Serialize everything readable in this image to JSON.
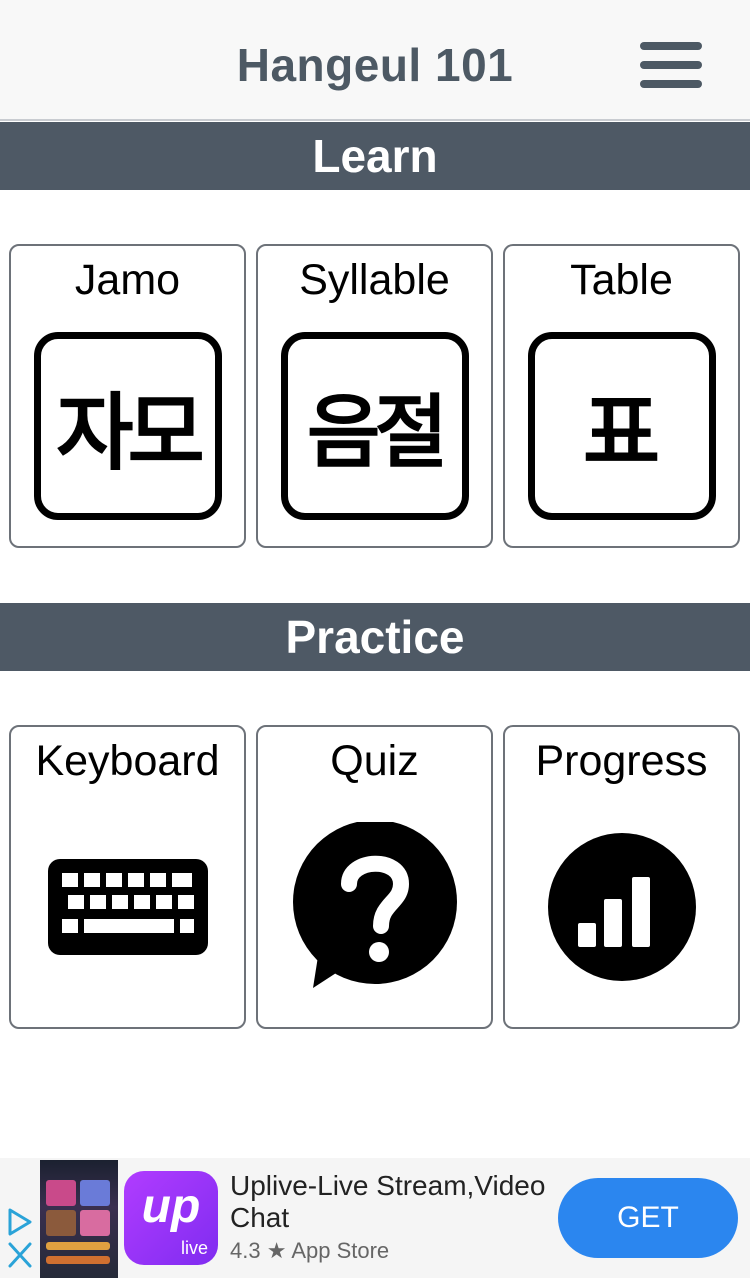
{
  "header": {
    "title": "Hangeul 101",
    "menu_icon": "hamburger-menu-icon"
  },
  "sections": {
    "learn": {
      "title": "Learn",
      "tiles": [
        {
          "label": "Jamo",
          "icon_text": "자모",
          "icon": "jamo-hangul-icon"
        },
        {
          "label": "Syllable",
          "icon_text": "음절",
          "icon": "syllable-hangul-icon"
        },
        {
          "label": "Table",
          "icon_text": "표",
          "icon": "table-hangul-icon"
        }
      ]
    },
    "practice": {
      "title": "Practice",
      "tiles": [
        {
          "label": "Keyboard",
          "icon": "keyboard-icon"
        },
        {
          "label": "Quiz",
          "icon": "question-bubble-icon"
        },
        {
          "label": "Progress",
          "icon": "bar-chart-circle-icon"
        }
      ]
    }
  },
  "ad": {
    "title": "Uplive-Live Stream,Video Chat",
    "rating": "4.3 ★ App Store",
    "cta": "GET",
    "logo_text": "up",
    "logo_sub": "live",
    "logo_color": "#9b35fb",
    "cta_color": "#2b86ef"
  },
  "colors": {
    "header_text": "#4d5964",
    "section_bar": "#4e5965"
  }
}
